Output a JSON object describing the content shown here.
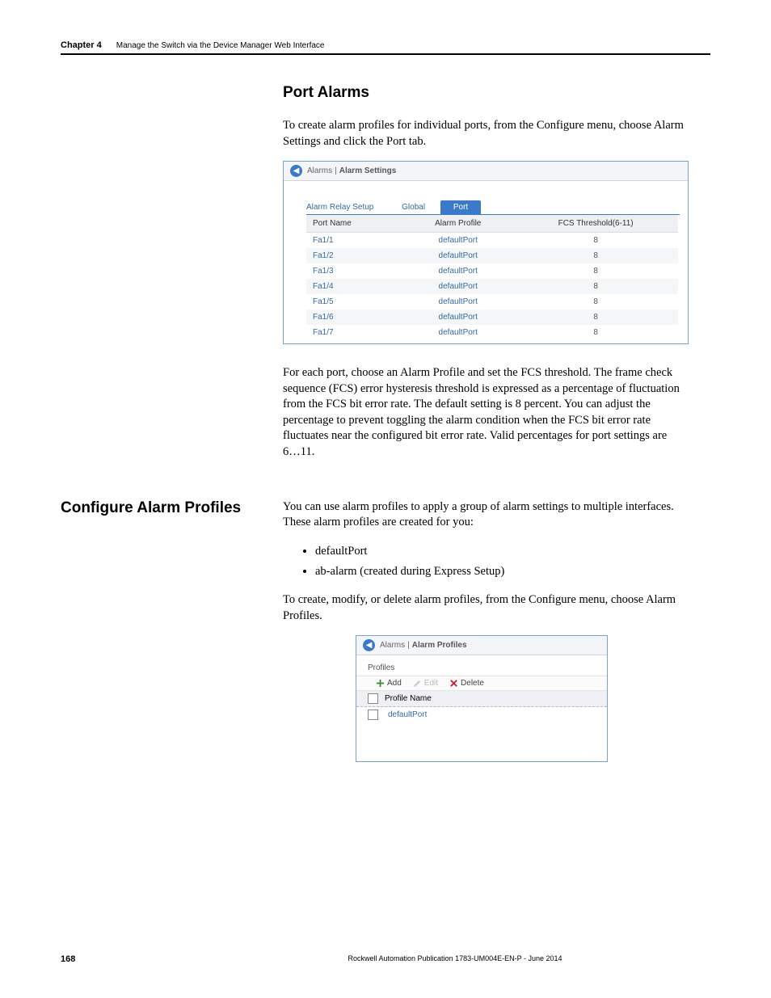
{
  "header": {
    "chapter": "Chapter 4",
    "desc": "Manage the Switch via the Device Manager Web Interface"
  },
  "section1": {
    "title": "Port Alarms",
    "para1": "To create alarm profiles for individual ports, from the Configure menu, choose Alarm Settings and click the Port tab.",
    "para2": "For each port, choose an Alarm Profile and set the FCS threshold. The frame check sequence (FCS) error hysteresis threshold is expressed as a percentage of fluctuation from the FCS bit error rate. The default setting is 8 percent. You can adjust the percentage to prevent toggling the alarm condition when the FCS bit error rate fluctuates near the configured bit error rate. Valid percentages for port settings are 6…11."
  },
  "section2": {
    "sideheading": "Configure Alarm Profiles",
    "para1": "You can use alarm profiles to apply a group of alarm settings to multiple interfaces. These alarm profiles are created for you:",
    "bullets": [
      "defaultPort",
      "ab-alarm (created during Express Setup)"
    ],
    "para2": "To create, modify, or delete alarm profiles, from the Configure menu, choose Alarm Profiles."
  },
  "screenshot1": {
    "breadcrumb_parent": "Alarms",
    "breadcrumb_current": "Alarm Settings",
    "tabs": {
      "t0": "Alarm Relay Setup",
      "t1": "Global",
      "t2": "Port"
    },
    "headers": {
      "h0": "Port Name",
      "h1": "Alarm Profile",
      "h2": "FCS Threshold(6-11)"
    },
    "rows": [
      {
        "port": "Fa1/1",
        "profile": "defaultPort",
        "fcs": "8"
      },
      {
        "port": "Fa1/2",
        "profile": "defaultPort",
        "fcs": "8"
      },
      {
        "port": "Fa1/3",
        "profile": "defaultPort",
        "fcs": "8"
      },
      {
        "port": "Fa1/4",
        "profile": "defaultPort",
        "fcs": "8"
      },
      {
        "port": "Fa1/5",
        "profile": "defaultPort",
        "fcs": "8"
      },
      {
        "port": "Fa1/6",
        "profile": "defaultPort",
        "fcs": "8"
      },
      {
        "port": "Fa1/7",
        "profile": "defaultPort",
        "fcs": "8"
      }
    ]
  },
  "screenshot2": {
    "breadcrumb_parent": "Alarms",
    "breadcrumb_current": "Alarm Profiles",
    "profiles_label": "Profiles",
    "toolbar": {
      "add": "Add",
      "edit": "Edit",
      "delete": "Delete"
    },
    "header": "Profile Name",
    "row0": "defaultPort"
  },
  "footer": {
    "page": "168",
    "pub": "Rockwell Automation Publication 1783-UM004E-EN-P - June 2014"
  }
}
